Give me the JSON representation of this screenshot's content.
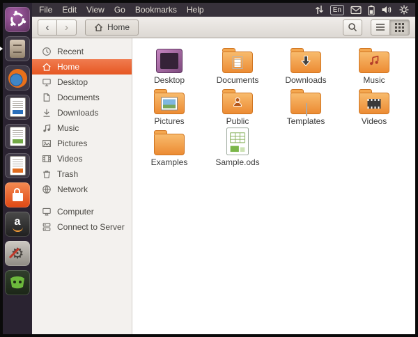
{
  "panel": {
    "menus": [
      "File",
      "Edit",
      "View",
      "Go",
      "Bookmarks",
      "Help"
    ],
    "keyboard_indicator": "En"
  },
  "launcher": {
    "items": [
      {
        "name": "Ubuntu Dash"
      },
      {
        "name": "Files"
      },
      {
        "name": "Firefox"
      },
      {
        "name": "LibreOffice Writer"
      },
      {
        "name": "LibreOffice Calc"
      },
      {
        "name": "LibreOffice Impress"
      },
      {
        "name": "Ubuntu Software Center"
      },
      {
        "name": "Amazon"
      },
      {
        "name": "System Settings"
      },
      {
        "name": "Screen Recorder"
      }
    ]
  },
  "toolbar": {
    "location": "Home"
  },
  "icons": {
    "back_chevron": "‹",
    "forward_chevron": "›",
    "settings_gear": "⚙",
    "amazon_a": "a"
  },
  "sidebar": {
    "places": [
      "Recent",
      "Home",
      "Desktop",
      "Documents",
      "Downloads",
      "Music",
      "Pictures",
      "Videos",
      "Trash",
      "Network"
    ],
    "devices": [
      "Computer",
      "Connect to Server"
    ],
    "selected": "Home"
  },
  "files": {
    "items": [
      {
        "label": "Desktop",
        "kind": "desktop-folder"
      },
      {
        "label": "Documents",
        "kind": "folder-documents"
      },
      {
        "label": "Downloads",
        "kind": "folder-downloads"
      },
      {
        "label": "Music",
        "kind": "folder-music"
      },
      {
        "label": "Pictures",
        "kind": "folder-pictures"
      },
      {
        "label": "Public",
        "kind": "folder-public"
      },
      {
        "label": "Templates",
        "kind": "folder-templates"
      },
      {
        "label": "Videos",
        "kind": "folder-videos"
      },
      {
        "label": "Examples",
        "kind": "folder"
      },
      {
        "label": "Sample.ods",
        "kind": "spreadsheet"
      }
    ]
  },
  "colors": {
    "selection_orange": "#E95420",
    "folder_orange": "#F0913C",
    "panel_bg": "#37313A",
    "launcher_bg": "#2A2331"
  }
}
